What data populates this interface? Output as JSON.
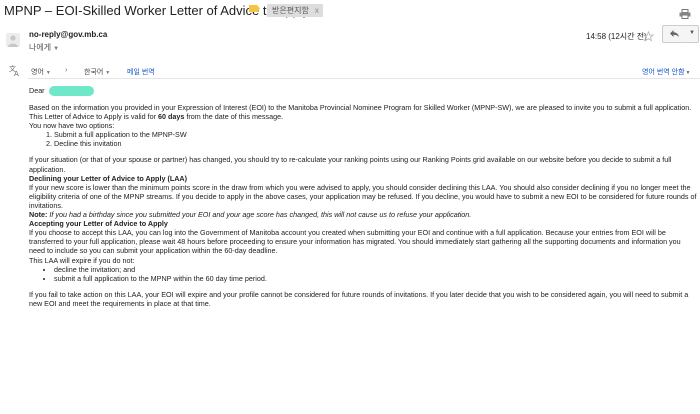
{
  "email": {
    "subject": "MPNP – EOI-Skilled Worker Letter of Advice to Apply",
    "label_chip": "받은편지함",
    "label_chip_remove": "x",
    "sender": "no-reply@gov.mb.ca",
    "recipient": "나에게",
    "time": "14:58 (12시간 전)"
  },
  "translation_bar": {
    "source_lang": "영어",
    "target_lang": "한국어",
    "translate_link": "메일 번역",
    "no_translate": "영어 번역 안함"
  },
  "body": {
    "greeting": "Dear",
    "p1": "Based on the information you provided in your Expression of Interest (EOI) to the Manitoba Provincial Nominee Program for Skilled Worker (MPNP-SW), we are pleased to invite you to submit a full application.",
    "p2_before": "This Letter of Advice to Apply is valid for ",
    "p2_bold": "60 days",
    "p2_after": " from the date of this message.",
    "p3": "You now have two options:",
    "options": [
      "Submit a full application to the MPNP-SW",
      "Decline this invitation"
    ],
    "p4": "If your situation (or that of your spouse or partner) has changed, you should try to re-calculate your ranking points using our Ranking Points grid available on our website before you decide to submit a full application.",
    "h1": "Declining your Letter of Advice to Apply (LAA)",
    "p5": "If your new score is lower than the minimum points score in the draw from which you were advised to apply, you should consider declining this LAA. You should also consider declining if you no longer meet the eligibility criteria of one of the MPNP streams. If you decide to apply in the above cases, your application may be refused. If you decline, you would have to submit a new EOI to be considered for future rounds of invitations.",
    "note_label": "Note:",
    "note_text": " If you had a birthday since you submitted your EOI and your age score has changed, this will not cause us to refuse your application.",
    "h2": "Accepting your Letter of Advice to Apply",
    "p6": "If you choose to accept this LAA, you can log into the Government of Manitoba account you created when submitting your EOI and continue with a full application. Because your entries from EOI will be transferred to your full application, please wait 48 hours before proceeding to ensure your information has migrated. You should immediately start gathering all the supporting documents and information you need to include so you can submit your application within the 60-day deadline.",
    "p7": "This LAA will expire if you do not:",
    "expire_items": [
      "decline the invitation; and",
      "submit a full application to the MPNP within the 60 day time period."
    ],
    "p8": "If you fail to take action on this LAA, your EOI will expire and your profile cannot be considered for future rounds of invitations. If you later decide that you wish to be considered again, you will need to submit a new EOI and meet the requirements in place at that time."
  },
  "icons": {
    "label": "label-tag-icon",
    "print": "print-icon",
    "avatar": "person-icon",
    "star": "star-icon",
    "reply": "reply-icon",
    "more": "chevron-down-icon",
    "translate": "translate-icon"
  },
  "colors": {
    "link": "#1155cc",
    "label_tag": "#f5c542",
    "redaction": "#6ee8c8"
  }
}
